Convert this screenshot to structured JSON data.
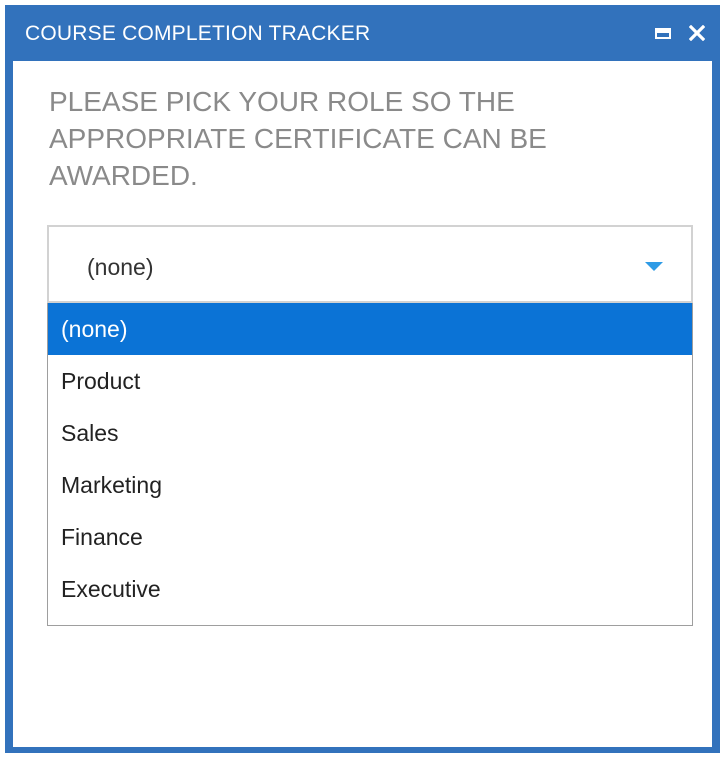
{
  "window": {
    "title": "COURSE COMPLETION TRACKER",
    "maximize_icon": "maximize-icon",
    "close_icon": "close-icon",
    "close_glyph": "✕",
    "frame_color": "#3272bc"
  },
  "form": {
    "instruction": "PLEASE PICK YOUR ROLE SO THE APPROPRIATE CERTIFICATE CAN BE AWARDED.",
    "select": {
      "value": "(none)",
      "arrow_icon": "chevron-down-icon",
      "arrow_color": "#2e9be6",
      "options": [
        {
          "label": "(none)",
          "selected": true
        },
        {
          "label": "Product",
          "selected": false
        },
        {
          "label": "Sales",
          "selected": false
        },
        {
          "label": "Marketing",
          "selected": false
        },
        {
          "label": "Finance",
          "selected": false
        },
        {
          "label": "Executive",
          "selected": false
        }
      ],
      "highlight_color": "#0b73d6"
    }
  }
}
